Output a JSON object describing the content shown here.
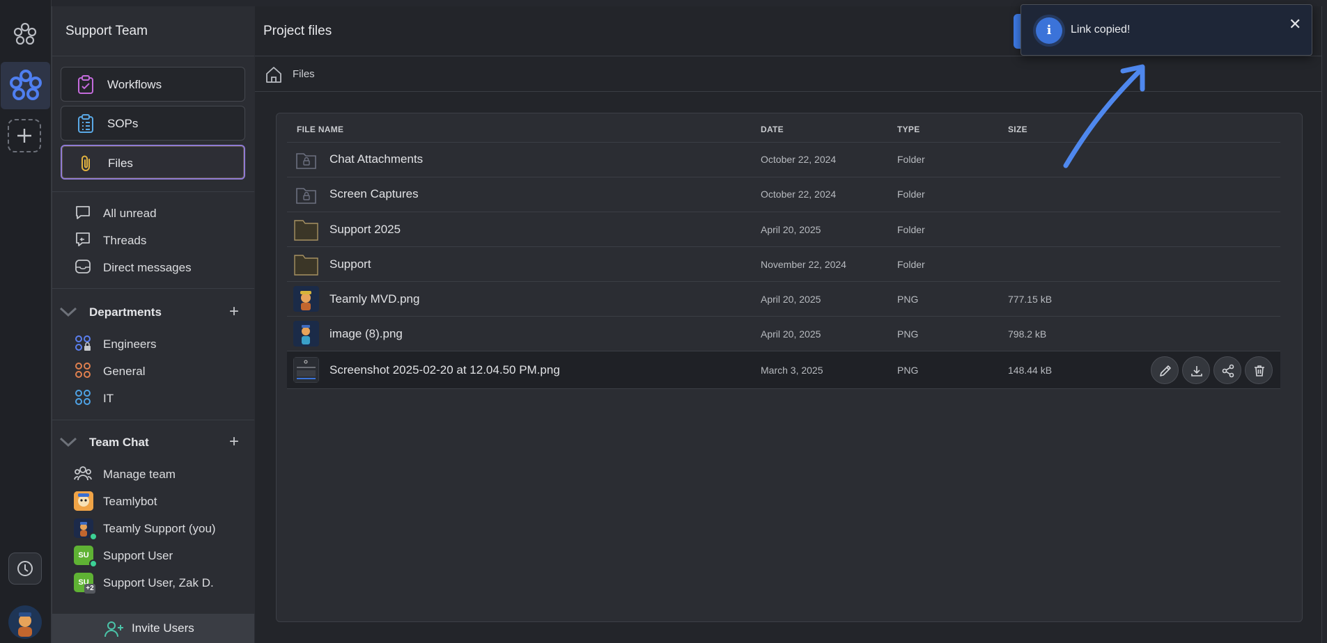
{
  "sidebar": {
    "team_name": "Support Team",
    "nav": [
      {
        "label": "Workflows"
      },
      {
        "label": "SOPs"
      },
      {
        "label": "Files"
      }
    ],
    "quick": [
      {
        "label": "All unread"
      },
      {
        "label": "Threads"
      },
      {
        "label": "Direct messages"
      }
    ],
    "departments": {
      "title": "Departments",
      "items": [
        {
          "label": "Engineers"
        },
        {
          "label": "General"
        },
        {
          "label": "IT"
        }
      ]
    },
    "team_chat": {
      "title": "Team Chat",
      "items": [
        {
          "label": "Manage team"
        },
        {
          "label": "Teamlybot"
        },
        {
          "label": "Teamly Support (you)"
        },
        {
          "label": "Support User",
          "initials": "SU"
        },
        {
          "label": "Support User, Zak D.",
          "initials": "SU",
          "extra": "+2"
        }
      ]
    },
    "invite_label": "Invite Users"
  },
  "main": {
    "title": "Project files",
    "breadcrumb": "Files",
    "columns": {
      "name": "FILE NAME",
      "date": "DATE",
      "type": "TYPE",
      "size": "SIZE"
    },
    "files": [
      {
        "name": "Chat Attachments",
        "date": "October 22, 2024",
        "type": "Folder",
        "size": ""
      },
      {
        "name": "Screen Captures",
        "date": "October 22, 2024",
        "type": "Folder",
        "size": ""
      },
      {
        "name": "Support 2025",
        "date": "April 20, 2025",
        "type": "Folder",
        "size": ""
      },
      {
        "name": "Support",
        "date": "November 22, 2024",
        "type": "Folder",
        "size": ""
      },
      {
        "name": "Teamly MVD.png",
        "date": "April 20, 2025",
        "type": "PNG",
        "size": "777.15 kB"
      },
      {
        "name": "image (8).png",
        "date": "April 20, 2025",
        "type": "PNG",
        "size": "798.2 kB"
      },
      {
        "name": "Screenshot 2025-02-20 at 12.04.50 PM.png",
        "date": "March 3, 2025",
        "type": "PNG",
        "size": "148.44 kB"
      }
    ]
  },
  "toast": {
    "message": "Link copied!",
    "icon": "info-icon",
    "close": "✕"
  },
  "colors": {
    "accent": "#3e7be6",
    "active_border": "#8f7bd4",
    "online": "#3cd196",
    "avatar_green": "#5fb234"
  }
}
